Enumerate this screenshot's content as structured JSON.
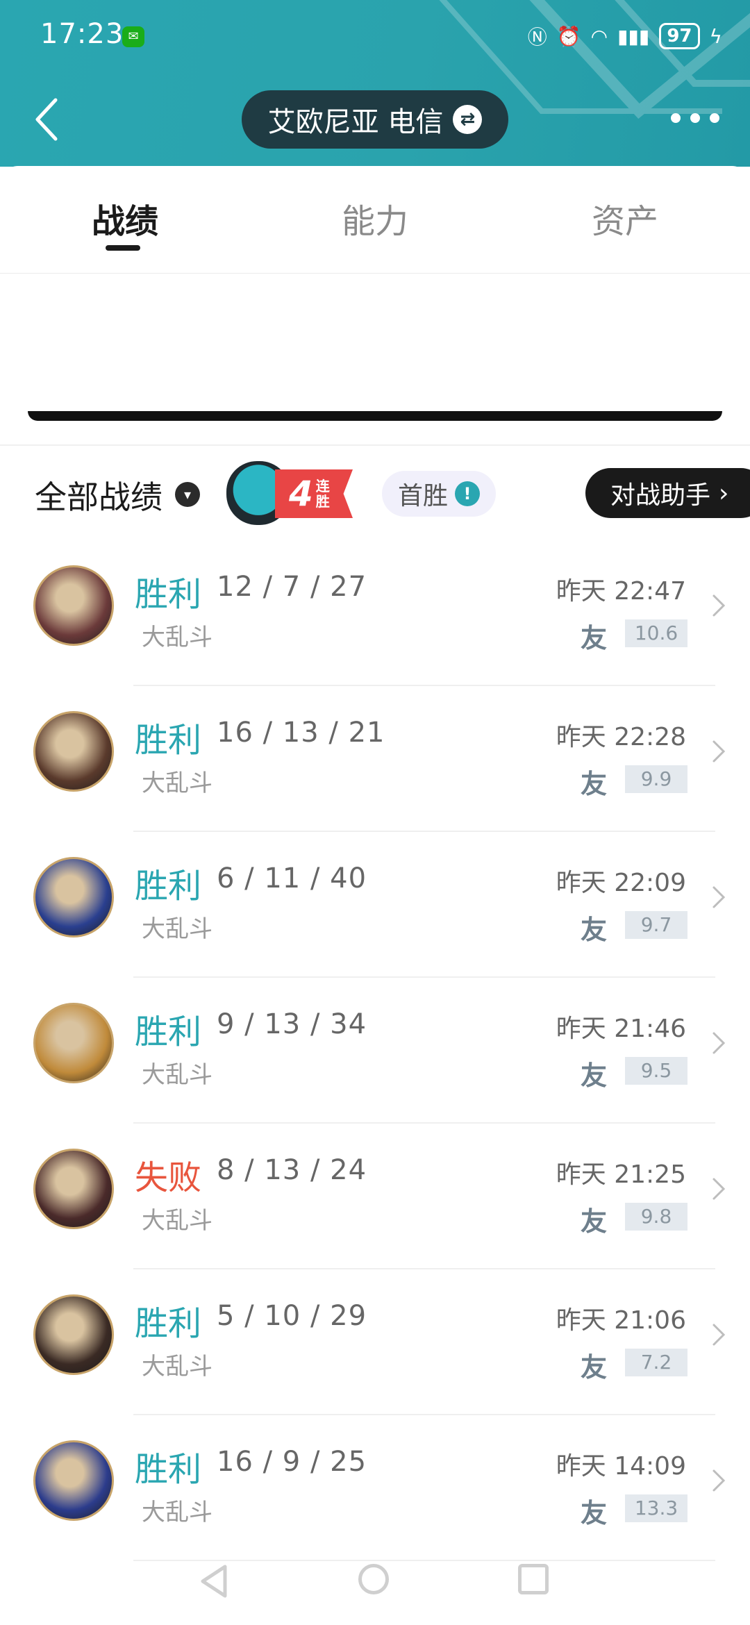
{
  "status_bar": {
    "time": "17:23",
    "battery": "97",
    "icons": [
      "wechat-icon",
      "nfc-icon",
      "alarm-icon",
      "wifi-icon",
      "signal-4g-icon",
      "battery-icon",
      "charging-icon"
    ]
  },
  "header": {
    "server": "艾欧尼亚 电信",
    "back_icon": "chevron-left-icon",
    "swap_icon": "swap-icon",
    "more_icon": "more-icon"
  },
  "tabs": [
    {
      "label": "战绩",
      "active": true
    },
    {
      "label": "能力",
      "active": false
    },
    {
      "label": "资产",
      "active": false
    }
  ],
  "filter": {
    "all_label": "全部战绩",
    "streak_number": "4",
    "streak_text": "连胜",
    "first_win": "首胜",
    "helper_button": "对战助手"
  },
  "matches": [
    {
      "result": "胜利",
      "outcome": "win",
      "kda": "12 / 7 / 27",
      "mode": "大乱斗",
      "time": "昨天 22:47",
      "friend": "友",
      "score": "10.6",
      "avatar_color": "#6b3a3a"
    },
    {
      "result": "胜利",
      "outcome": "win",
      "kda": "16 / 13 / 21",
      "mode": "大乱斗",
      "time": "昨天 22:28",
      "friend": "友",
      "score": "9.9",
      "avatar_color": "#5a3a2c"
    },
    {
      "result": "胜利",
      "outcome": "win",
      "kda": "6 / 11 / 40",
      "mode": "大乱斗",
      "time": "昨天 22:09",
      "friend": "友",
      "score": "9.7",
      "avatar_color": "#2a3f8f"
    },
    {
      "result": "胜利",
      "outcome": "win",
      "kda": "9 / 13 / 34",
      "mode": "大乱斗",
      "time": "昨天 21:46",
      "friend": "友",
      "score": "9.5",
      "avatar_color": "#c08a3a"
    },
    {
      "result": "失败",
      "outcome": "lose",
      "kda": "8 / 13 / 24",
      "mode": "大乱斗",
      "time": "昨天 21:25",
      "friend": "友",
      "score": "9.8",
      "avatar_color": "#4a2a2a"
    },
    {
      "result": "胜利",
      "outcome": "win",
      "kda": "5 / 10 / 29",
      "mode": "大乱斗",
      "time": "昨天 21:06",
      "friend": "友",
      "score": "7.2",
      "avatar_color": "#3a2a24"
    },
    {
      "result": "胜利",
      "outcome": "win",
      "kda": "16 / 9 / 25",
      "mode": "大乱斗",
      "time": "昨天 14:09",
      "friend": "友",
      "score": "13.3",
      "avatar_color": "#2c3c8c"
    }
  ],
  "colors": {
    "header_bg": "#2aa6b1",
    "win": "#2aa6b1",
    "lose": "#e8553d"
  }
}
